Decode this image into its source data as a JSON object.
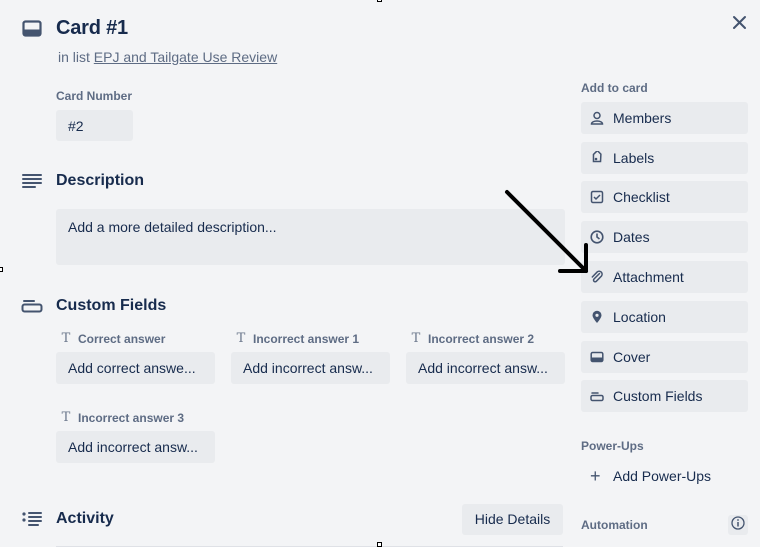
{
  "card": {
    "title": "Card #1",
    "in_list_prefix": "in list",
    "list_name": "EPJ and Tailgate Use Review",
    "card_number_label": "Card Number",
    "card_number_value": "#2"
  },
  "description": {
    "title": "Description",
    "placeholder": "Add a more detailed description..."
  },
  "custom_fields": {
    "title": "Custom Fields",
    "fields": [
      {
        "label": "Correct answer",
        "placeholder": "Add correct answe..."
      },
      {
        "label": "Incorrect answer 1",
        "placeholder": "Add incorrect answ..."
      },
      {
        "label": "Incorrect answer 2",
        "placeholder": "Add incorrect answ..."
      },
      {
        "label": "Incorrect answer 3",
        "placeholder": "Add incorrect answ..."
      }
    ]
  },
  "activity": {
    "title": "Activity",
    "hide_details_label": "Hide Details"
  },
  "sidebar": {
    "add_to_card_heading": "Add to card",
    "items": [
      {
        "label": "Members",
        "icon": "person-icon"
      },
      {
        "label": "Labels",
        "icon": "tag-icon"
      },
      {
        "label": "Checklist",
        "icon": "checklist-icon"
      },
      {
        "label": "Dates",
        "icon": "clock-icon"
      },
      {
        "label": "Attachment",
        "icon": "paperclip-icon"
      },
      {
        "label": "Location",
        "icon": "location-pin-icon"
      },
      {
        "label": "Cover",
        "icon": "cover-icon"
      },
      {
        "label": "Custom Fields",
        "icon": "custom-fields-icon"
      }
    ],
    "powerups_heading": "Power-Ups",
    "add_powerups_label": "Add Power-Ups",
    "automation_heading": "Automation"
  },
  "colors": {
    "background": "#f3f4f6",
    "button_bg": "#e9ebee",
    "text_primary": "#172b4d",
    "text_secondary": "#5e6c84"
  }
}
